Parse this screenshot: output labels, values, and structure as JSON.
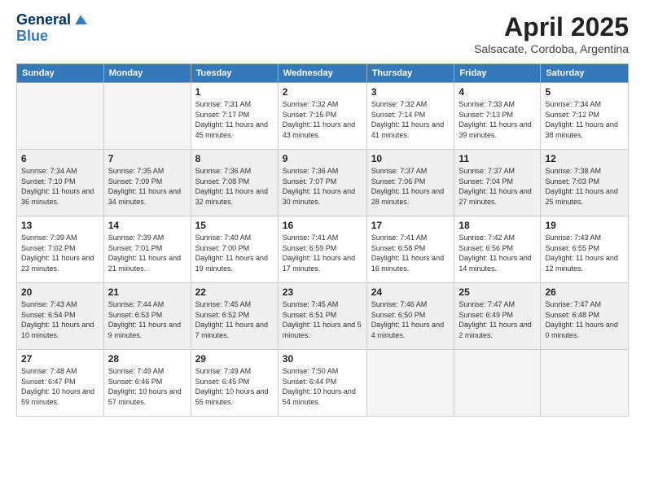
{
  "header": {
    "logo_line1": "General",
    "logo_line2": "Blue",
    "title": "April 2025",
    "subtitle": "Salsacate, Cordoba, Argentina"
  },
  "days_of_week": [
    "Sunday",
    "Monday",
    "Tuesday",
    "Wednesday",
    "Thursday",
    "Friday",
    "Saturday"
  ],
  "weeks": [
    [
      {
        "day": "",
        "sunrise": "",
        "sunset": "",
        "daylight": ""
      },
      {
        "day": "",
        "sunrise": "",
        "sunset": "",
        "daylight": ""
      },
      {
        "day": "1",
        "sunrise": "Sunrise: 7:31 AM",
        "sunset": "Sunset: 7:17 PM",
        "daylight": "Daylight: 11 hours and 45 minutes."
      },
      {
        "day": "2",
        "sunrise": "Sunrise: 7:32 AM",
        "sunset": "Sunset: 7:15 PM",
        "daylight": "Daylight: 11 hours and 43 minutes."
      },
      {
        "day": "3",
        "sunrise": "Sunrise: 7:32 AM",
        "sunset": "Sunset: 7:14 PM",
        "daylight": "Daylight: 11 hours and 41 minutes."
      },
      {
        "day": "4",
        "sunrise": "Sunrise: 7:33 AM",
        "sunset": "Sunset: 7:13 PM",
        "daylight": "Daylight: 11 hours and 39 minutes."
      },
      {
        "day": "5",
        "sunrise": "Sunrise: 7:34 AM",
        "sunset": "Sunset: 7:12 PM",
        "daylight": "Daylight: 11 hours and 38 minutes."
      }
    ],
    [
      {
        "day": "6",
        "sunrise": "Sunrise: 7:34 AM",
        "sunset": "Sunset: 7:10 PM",
        "daylight": "Daylight: 11 hours and 36 minutes."
      },
      {
        "day": "7",
        "sunrise": "Sunrise: 7:35 AM",
        "sunset": "Sunset: 7:09 PM",
        "daylight": "Daylight: 11 hours and 34 minutes."
      },
      {
        "day": "8",
        "sunrise": "Sunrise: 7:36 AM",
        "sunset": "Sunset: 7:08 PM",
        "daylight": "Daylight: 11 hours and 32 minutes."
      },
      {
        "day": "9",
        "sunrise": "Sunrise: 7:36 AM",
        "sunset": "Sunset: 7:07 PM",
        "daylight": "Daylight: 11 hours and 30 minutes."
      },
      {
        "day": "10",
        "sunrise": "Sunrise: 7:37 AM",
        "sunset": "Sunset: 7:06 PM",
        "daylight": "Daylight: 11 hours and 28 minutes."
      },
      {
        "day": "11",
        "sunrise": "Sunrise: 7:37 AM",
        "sunset": "Sunset: 7:04 PM",
        "daylight": "Daylight: 11 hours and 27 minutes."
      },
      {
        "day": "12",
        "sunrise": "Sunrise: 7:38 AM",
        "sunset": "Sunset: 7:03 PM",
        "daylight": "Daylight: 11 hours and 25 minutes."
      }
    ],
    [
      {
        "day": "13",
        "sunrise": "Sunrise: 7:39 AM",
        "sunset": "Sunset: 7:02 PM",
        "daylight": "Daylight: 11 hours and 23 minutes."
      },
      {
        "day": "14",
        "sunrise": "Sunrise: 7:39 AM",
        "sunset": "Sunset: 7:01 PM",
        "daylight": "Daylight: 11 hours and 21 minutes."
      },
      {
        "day": "15",
        "sunrise": "Sunrise: 7:40 AM",
        "sunset": "Sunset: 7:00 PM",
        "daylight": "Daylight: 11 hours and 19 minutes."
      },
      {
        "day": "16",
        "sunrise": "Sunrise: 7:41 AM",
        "sunset": "Sunset: 6:59 PM",
        "daylight": "Daylight: 11 hours and 17 minutes."
      },
      {
        "day": "17",
        "sunrise": "Sunrise: 7:41 AM",
        "sunset": "Sunset: 6:58 PM",
        "daylight": "Daylight: 11 hours and 16 minutes."
      },
      {
        "day": "18",
        "sunrise": "Sunrise: 7:42 AM",
        "sunset": "Sunset: 6:56 PM",
        "daylight": "Daylight: 11 hours and 14 minutes."
      },
      {
        "day": "19",
        "sunrise": "Sunrise: 7:43 AM",
        "sunset": "Sunset: 6:55 PM",
        "daylight": "Daylight: 11 hours and 12 minutes."
      }
    ],
    [
      {
        "day": "20",
        "sunrise": "Sunrise: 7:43 AM",
        "sunset": "Sunset: 6:54 PM",
        "daylight": "Daylight: 11 hours and 10 minutes."
      },
      {
        "day": "21",
        "sunrise": "Sunrise: 7:44 AM",
        "sunset": "Sunset: 6:53 PM",
        "daylight": "Daylight: 11 hours and 9 minutes."
      },
      {
        "day": "22",
        "sunrise": "Sunrise: 7:45 AM",
        "sunset": "Sunset: 6:52 PM",
        "daylight": "Daylight: 11 hours and 7 minutes."
      },
      {
        "day": "23",
        "sunrise": "Sunrise: 7:45 AM",
        "sunset": "Sunset: 6:51 PM",
        "daylight": "Daylight: 11 hours and 5 minutes."
      },
      {
        "day": "24",
        "sunrise": "Sunrise: 7:46 AM",
        "sunset": "Sunset: 6:50 PM",
        "daylight": "Daylight: 11 hours and 4 minutes."
      },
      {
        "day": "25",
        "sunrise": "Sunrise: 7:47 AM",
        "sunset": "Sunset: 6:49 PM",
        "daylight": "Daylight: 11 hours and 2 minutes."
      },
      {
        "day": "26",
        "sunrise": "Sunrise: 7:47 AM",
        "sunset": "Sunset: 6:48 PM",
        "daylight": "Daylight: 11 hours and 0 minutes."
      }
    ],
    [
      {
        "day": "27",
        "sunrise": "Sunrise: 7:48 AM",
        "sunset": "Sunset: 6:47 PM",
        "daylight": "Daylight: 10 hours and 59 minutes."
      },
      {
        "day": "28",
        "sunrise": "Sunrise: 7:49 AM",
        "sunset": "Sunset: 6:46 PM",
        "daylight": "Daylight: 10 hours and 57 minutes."
      },
      {
        "day": "29",
        "sunrise": "Sunrise: 7:49 AM",
        "sunset": "Sunset: 6:45 PM",
        "daylight": "Daylight: 10 hours and 55 minutes."
      },
      {
        "day": "30",
        "sunrise": "Sunrise: 7:50 AM",
        "sunset": "Sunset: 6:44 PM",
        "daylight": "Daylight: 10 hours and 54 minutes."
      },
      {
        "day": "",
        "sunrise": "",
        "sunset": "",
        "daylight": ""
      },
      {
        "day": "",
        "sunrise": "",
        "sunset": "",
        "daylight": ""
      },
      {
        "day": "",
        "sunrise": "",
        "sunset": "",
        "daylight": ""
      }
    ]
  ]
}
